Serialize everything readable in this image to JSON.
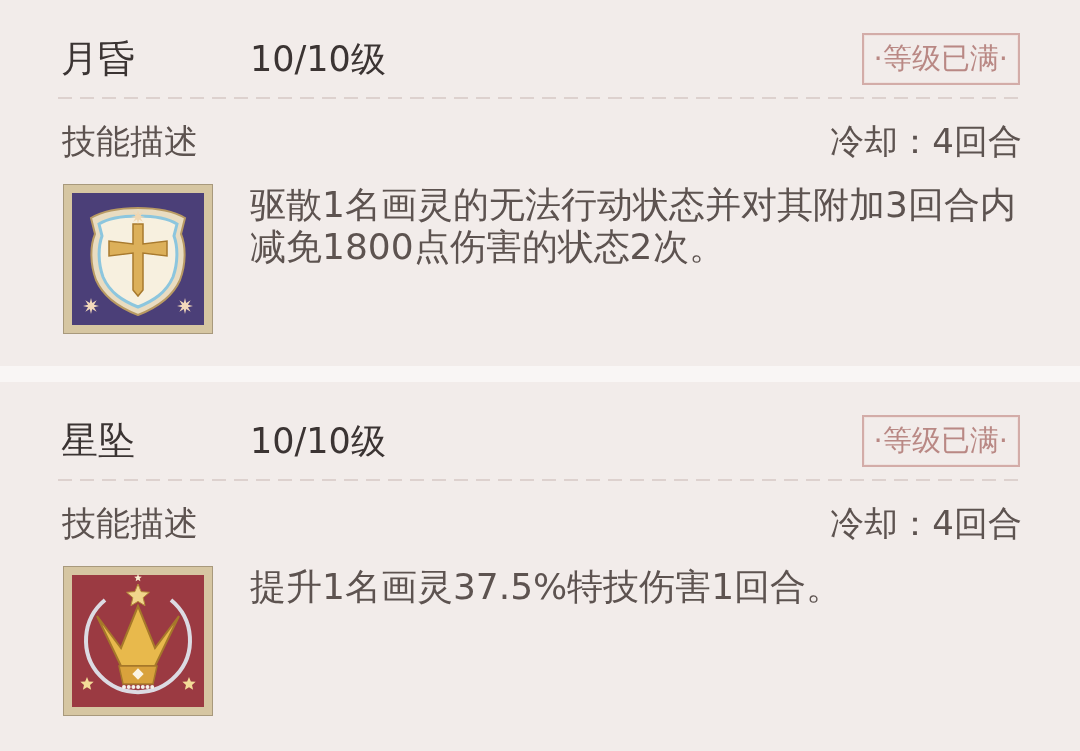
{
  "skills": [
    {
      "kind": "shield",
      "name": "月昏",
      "level_text": "10/10级",
      "badge": "·等级已满·",
      "section_label": "技能描述",
      "cooldown": "冷却：4回合",
      "description": "驱散1名画灵的无法行动状态并对其附加3回合内减免1800点伤害的状态2次。"
    },
    {
      "kind": "crown",
      "name": "星坠",
      "level_text": "10/10级",
      "badge": "·等级已满·",
      "section_label": "技能描述",
      "cooldown": "冷却：4回合",
      "description": "提升1名画灵37.5%特技伤害1回合。"
    }
  ]
}
